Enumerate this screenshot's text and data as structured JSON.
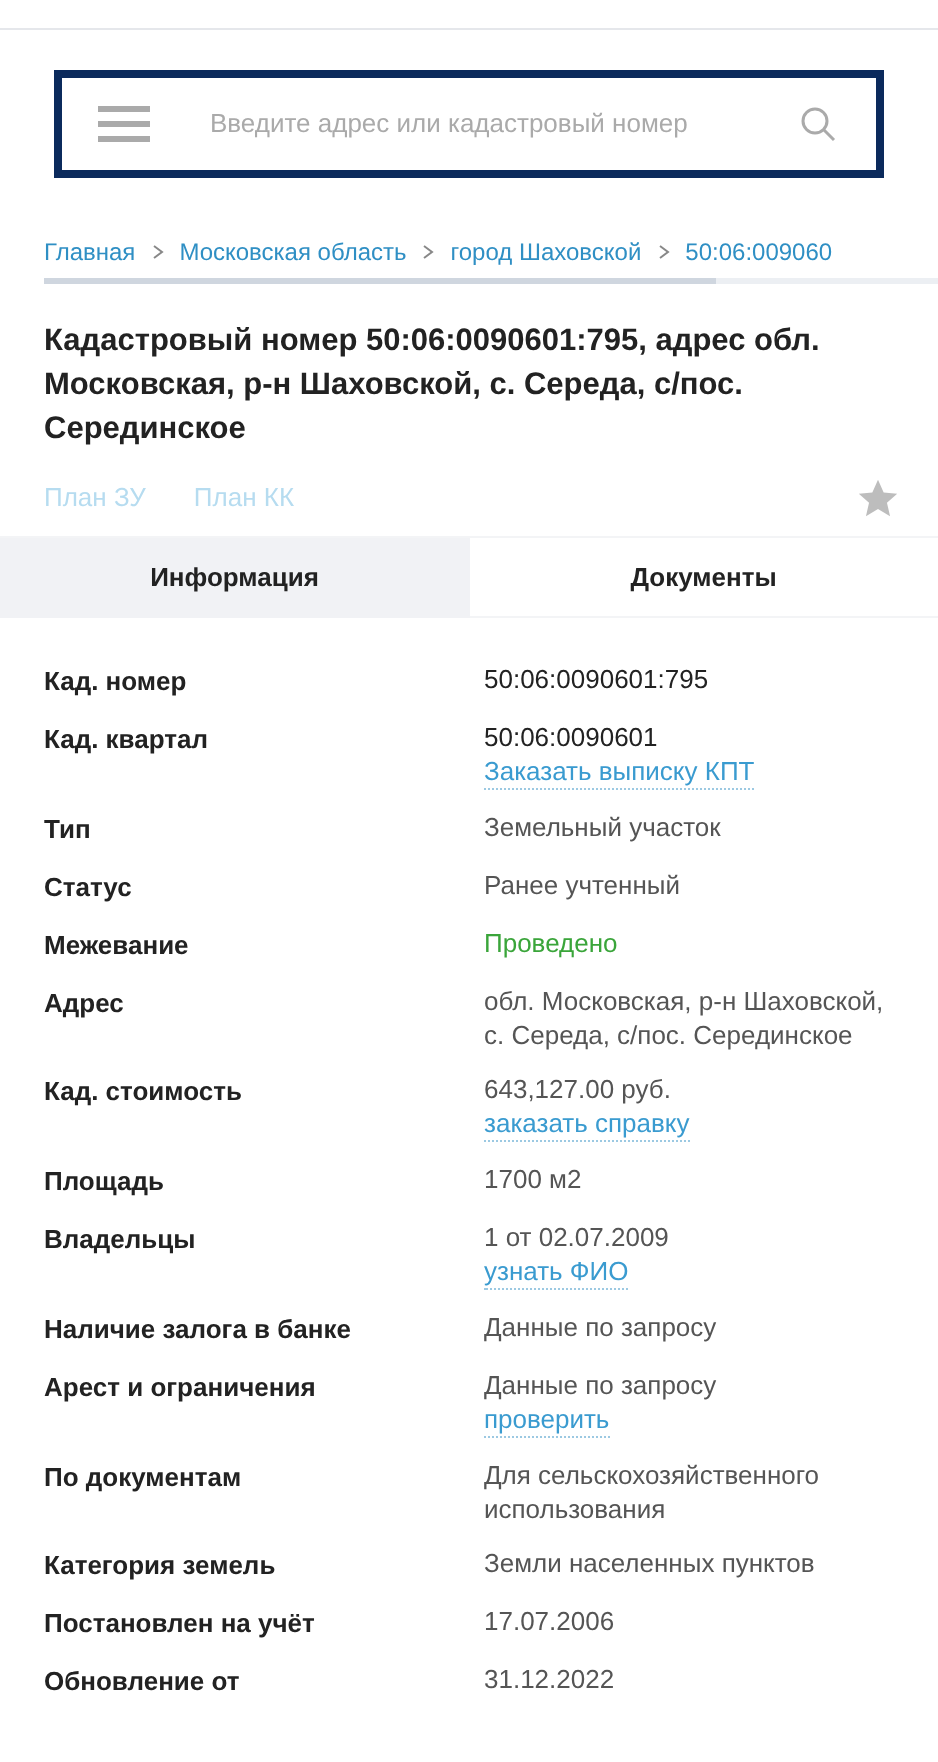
{
  "search": {
    "placeholder": "Введите адрес или кадастровый номер"
  },
  "breadcrumbs": [
    "Главная",
    "Московская область",
    "город Шаховской",
    "50:06:009060"
  ],
  "title": "Кадастровый номер 50:06:0090601:795, адрес обл. Московская, р-н Шаховской, с. Середа, с/пос. Серединское",
  "plan_links": [
    "План ЗУ",
    "План КК"
  ],
  "favorite": {
    "on": false
  },
  "tabs": [
    {
      "label": "Информация",
      "selected": true
    },
    {
      "label": "Документы",
      "selected": false
    }
  ],
  "rows": [
    {
      "label": "Кад. номер",
      "value": "50:06:0090601:795",
      "kind": "plain"
    },
    {
      "label": "Кад. квартал",
      "value": "50:06:0090601",
      "link": "Заказать выписку КПТ",
      "kind": "plain"
    },
    {
      "label": "Тип",
      "value": "Земельный участок",
      "kind": "muted"
    },
    {
      "label": "Статус",
      "value": "Ранее учтенный",
      "kind": "muted"
    },
    {
      "label": "Межевание",
      "value": "Проведено",
      "kind": "positive"
    },
    {
      "label": "Адрес",
      "value": "обл. Московская, р-н Шаховской, с. Середа, с/пос. Серединское",
      "kind": "muted"
    },
    {
      "label": "Кад. стоимость",
      "value": "643,127.00 руб.",
      "link": "заказать справку",
      "kind": "muted"
    },
    {
      "label": "Площадь",
      "value": "1700 м2",
      "kind": "muted"
    },
    {
      "label": "Владельцы",
      "value": "1 от 02.07.2009",
      "link": "узнать ФИО",
      "kind": "muted"
    },
    {
      "label": "Наличие залога в банке",
      "value": "Данные по запросу",
      "kind": "muted"
    },
    {
      "label": "Арест и ограничения",
      "value": "Данные по запросу",
      "link": "проверить",
      "kind": "muted"
    },
    {
      "label": "По документам",
      "value": "Для сельскохозяйственного использования",
      "kind": "muted"
    },
    {
      "label": "Категория земель",
      "value": "Земли населенных пунктов",
      "kind": "muted"
    },
    {
      "label": "Постановлен на учёт",
      "value": "17.07.2006",
      "kind": "muted"
    },
    {
      "label": "Обновление от",
      "value": "31.12.2022",
      "kind": "muted"
    }
  ]
}
